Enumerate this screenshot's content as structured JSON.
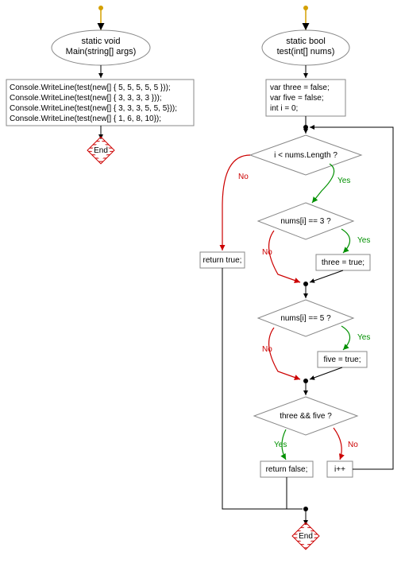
{
  "chart_data": {
    "type": "flowchart",
    "left_flow": {
      "start": {
        "label1": "static void",
        "label2": "Main(string[] args)"
      },
      "process": [
        "Console.WriteLine(test(new[] { 5, 5, 5, 5, 5 }));",
        "Console.WriteLine(test(new[] { 3, 3, 3, 3 }));",
        "Console.WriteLine(test(new[] { 3, 3, 3, 5, 5, 5}));",
        "Console.WriteLine(test(new[] { 1, 6, 8, 10});"
      ],
      "end": "End"
    },
    "right_flow": {
      "start": {
        "label1": "static bool",
        "label2": "test(int[] nums)"
      },
      "init": [
        "var three = false;",
        "var five = false;",
        "int i = 0;"
      ],
      "decision1": "i < nums.Length ?",
      "decision1_no_action": "return true;",
      "decision2": "nums[i] == 3 ?",
      "decision2_yes_action": "three = true;",
      "decision3": "nums[i] == 5 ?",
      "decision3_yes_action": "five = true;",
      "decision4": "three && five ?",
      "decision4_yes_action": "return false;",
      "decision4_no_action": "i++",
      "end": "End",
      "labels": {
        "yes": "Yes",
        "no": "No"
      }
    }
  }
}
